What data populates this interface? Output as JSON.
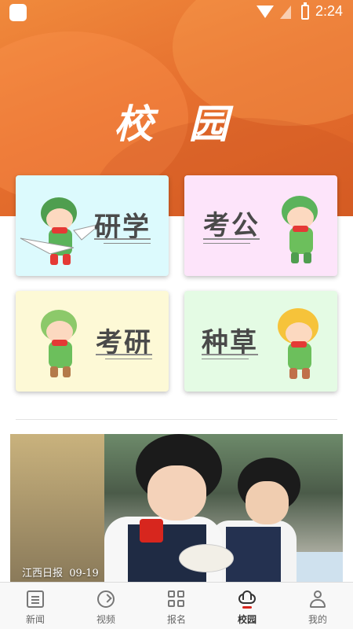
{
  "status_bar": {
    "time": "2:24",
    "icons": [
      "app-icon",
      "wifi-icon",
      "no-sim-icon",
      "battery-charging-icon"
    ]
  },
  "hero": {
    "title": "校 园",
    "colors": {
      "start": "#f08a3c",
      "end": "#d95f24"
    }
  },
  "cards": [
    {
      "label": "研学",
      "background": "#dcfafd",
      "illustration": "aviator-mascot-paper-plane"
    },
    {
      "label": "考公",
      "background": "#fde4fa",
      "illustration": "mascot-reading-book"
    },
    {
      "label": "考研",
      "background": "#fdf9d6",
      "illustration": "mascot-sitting-on-books"
    },
    {
      "label": "种草",
      "background": "#e4fbe4",
      "illustration": "mascot-sunflower"
    }
  ],
  "news": {
    "source": "江西日报",
    "date": "09-19",
    "image": "students-painting-fans-photo"
  },
  "tabbar": {
    "items": [
      {
        "label": "新闻",
        "icon": "news-icon",
        "active": false
      },
      {
        "label": "视频",
        "icon": "video-icon",
        "active": false
      },
      {
        "label": "报名",
        "icon": "signup-grid-icon",
        "active": false
      },
      {
        "label": "校园",
        "icon": "campus-cloud-icon",
        "active": true
      },
      {
        "label": "我的",
        "icon": "profile-icon",
        "active": false
      }
    ],
    "active_color": "#d7261e"
  }
}
